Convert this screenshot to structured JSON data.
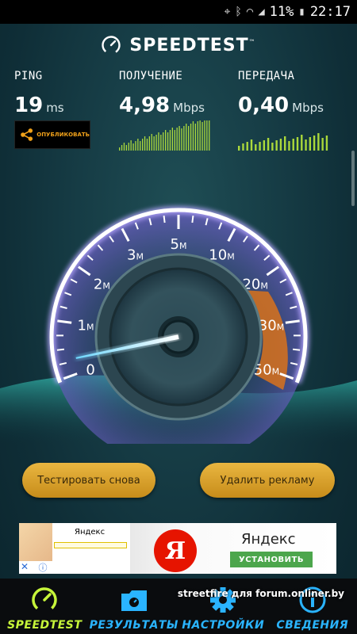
{
  "status_bar": {
    "battery": "11%",
    "time": "22:17"
  },
  "brand": {
    "name": "SPEEDTEST",
    "tm": "™"
  },
  "metrics": {
    "ping": {
      "label": "PING",
      "value": "19",
      "unit": "ms"
    },
    "download": {
      "label": "ПОЛУЧЕНИЕ",
      "value": "4,98",
      "unit": "Mbps"
    },
    "upload": {
      "label": "ПЕРЕДАЧА",
      "value": "0,40",
      "unit": "Mbps"
    }
  },
  "share_button": {
    "label": "ОПУБЛИКОВАТЬ"
  },
  "gauge": {
    "ticks": [
      "0",
      "1",
      "2",
      "3",
      "5",
      "10",
      "20",
      "30",
      "50"
    ],
    "unit_suffix": "M",
    "needle_value": 0.3
  },
  "buttons": {
    "test_again": "Тестировать снова",
    "remove_ads": "Удалить рекламу"
  },
  "ad": {
    "small_brand": "Яндекс",
    "logo_letter": "Я",
    "name": "Яндекс",
    "install": "УСТАНОВИТЬ"
  },
  "nav": {
    "items": [
      {
        "label": "SPEEDTEST",
        "icon": "gauge-icon",
        "active": true
      },
      {
        "label": "РЕЗУЛЬТАТЫ",
        "icon": "folder-icon",
        "active": false
      },
      {
        "label": "НАСТРОЙКИ",
        "icon": "gear-icon",
        "active": false
      },
      {
        "label": "СВЕДЕНИЯ",
        "icon": "info-icon",
        "active": false
      }
    ]
  },
  "watermark": "streetfire для forum.onliner.by",
  "colors": {
    "accent_green": "#c6f53a",
    "nav_blue": "#2ab4ff",
    "button_gold": "#e9b640",
    "share_orange": "#f0a11a"
  }
}
